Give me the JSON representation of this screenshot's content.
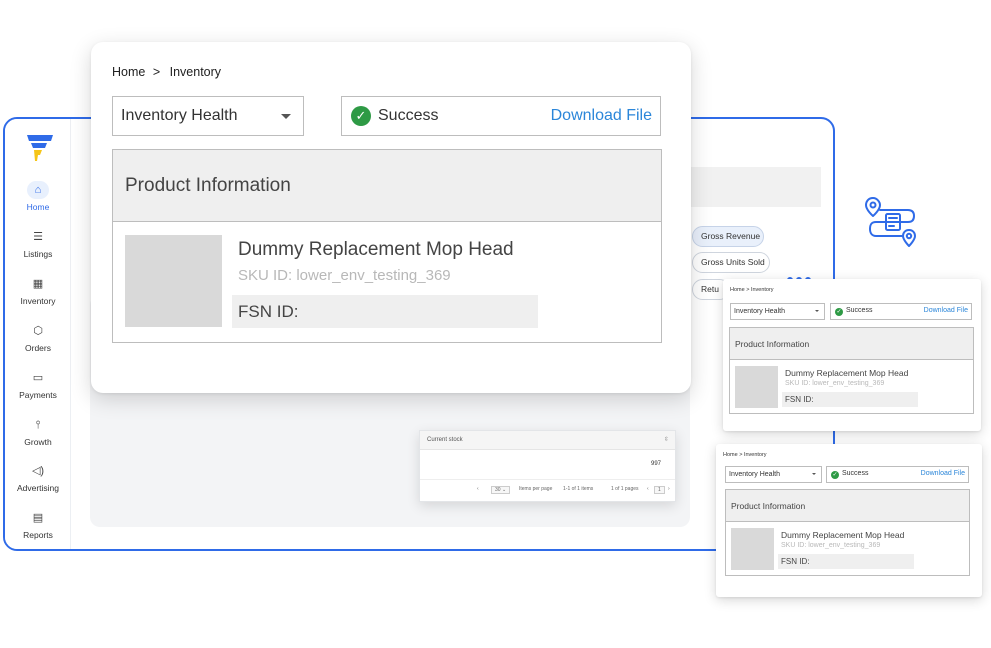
{
  "dashboard": {
    "nav": [
      {
        "label": "Home",
        "icon": "home-icon",
        "active": true
      },
      {
        "label": "Listings",
        "icon": "list-icon"
      },
      {
        "label": "Inventory",
        "icon": "warehouse-icon"
      },
      {
        "label": "Orders",
        "icon": "box-icon"
      },
      {
        "label": "Payments",
        "icon": "card-icon"
      },
      {
        "label": "Growth",
        "icon": "growth-icon"
      },
      {
        "label": "Advertising",
        "icon": "megaphone-icon"
      },
      {
        "label": "Reports",
        "icon": "report-icon"
      }
    ],
    "chips": [
      "Gross Revenue",
      "Gross Units Sold",
      "Retu"
    ],
    "accent_color": "#2f6be8"
  },
  "stock_table": {
    "header": "Current stock",
    "value": "997",
    "per_page": "30",
    "items_per_page_label": "Items per page",
    "items_range": "1-1 of 1 items",
    "pages": "1 of 1 pages",
    "page_number": "1"
  },
  "main_card": {
    "breadcrumb": {
      "home": "Home",
      "separator": ">",
      "current": "Inventory"
    },
    "select_value": "Inventory Health",
    "status_label": "Success",
    "download_label": "Download File",
    "panel_title": "Product Information",
    "product_name": "Dummy Replacement Mop Head",
    "sku": "SKU ID: lower_env_testing_369",
    "fsn": "FSN ID:",
    "success_color": "#2e9a45",
    "link_color": "#2b86d9"
  },
  "mini_card_1": {
    "breadcrumb": "Home > Inventory",
    "select_value": "Inventory Health",
    "status_label": "Success",
    "download_label": "Download File",
    "panel_title": "Product Information",
    "product_name": "Dummy Replacement Mop Head",
    "sku": "SKU ID: lower_env_testing_369",
    "fsn": "FSN ID:"
  },
  "mini_card_2": {
    "breadcrumb": "Home > Inventory",
    "select_value": "Inventory Health",
    "status_label": "Success",
    "download_label": "Download File",
    "panel_title": "Product Information",
    "product_name": "Dummy Replacement Mop Head",
    "sku": "SKU ID: lower_env_testing_369",
    "fsn": "FSN ID:"
  },
  "icons": {
    "checkmark": "✓",
    "sort": "⇳",
    "chevron_left": "‹",
    "chevron_right": "›",
    "dropdown": "⌄"
  }
}
